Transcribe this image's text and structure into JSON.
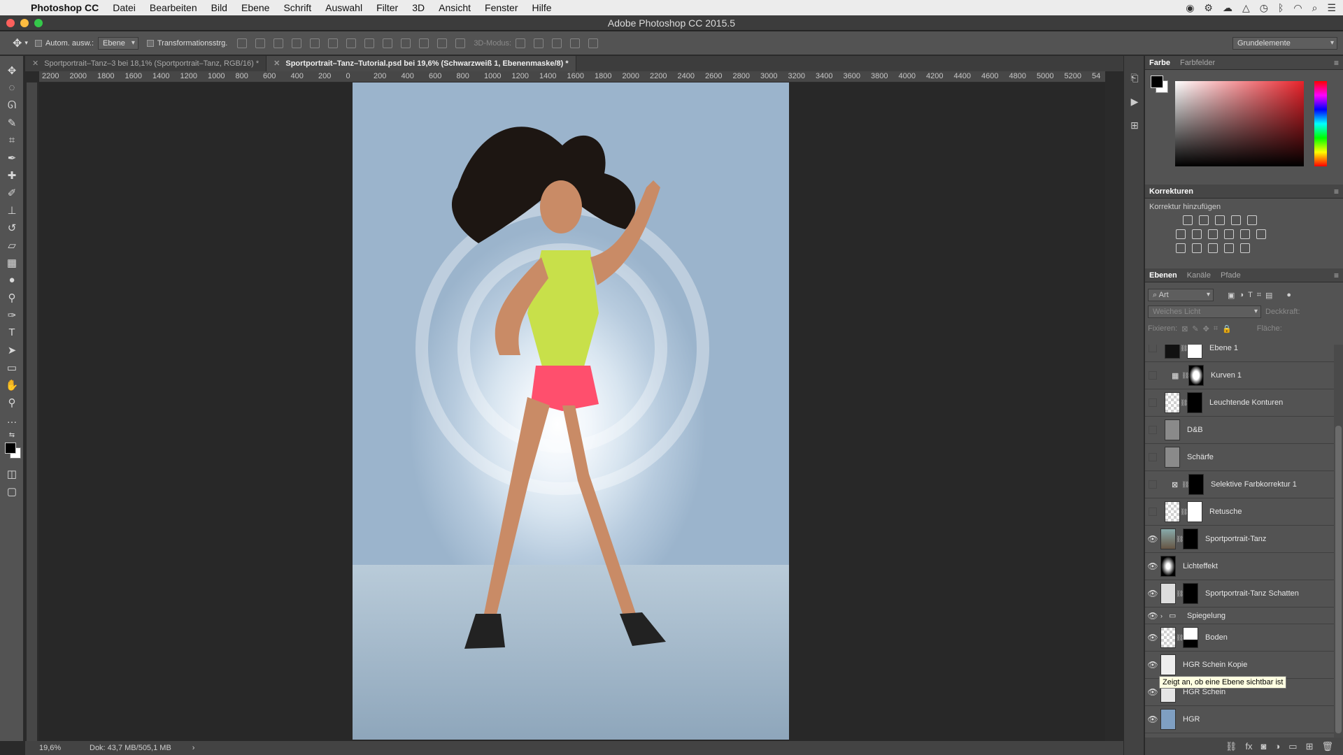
{
  "menubar": {
    "app": "Photoshop CC",
    "items": [
      "Datei",
      "Bearbeiten",
      "Bild",
      "Ebene",
      "Schrift",
      "Auswahl",
      "Filter",
      "3D",
      "Ansicht",
      "Fenster",
      "Hilfe"
    ]
  },
  "window": {
    "title": "Adobe Photoshop CC 2015.5"
  },
  "options": {
    "auto_select_label": "Autom. ausw.:",
    "auto_select_value": "Ebene",
    "transform_label": "Transformationsstrg.",
    "mode3d_label": "3D-Modus:",
    "workspace": "Grundelemente"
  },
  "tabs": [
    {
      "label": "Sportportrait–Tanz–3 bei 18,1% (Sportportrait–Tanz, RGB/16) *"
    },
    {
      "label": "Sportportrait–Tanz–Tutorial.psd bei 19,6% (Schwarzweiß 1, Ebenenmaske/8) *"
    }
  ],
  "ruler_ticks": [
    "2200",
    "2000",
    "1800",
    "1600",
    "1400",
    "1200",
    "1000",
    "800",
    "600",
    "400",
    "200",
    "0",
    "200",
    "400",
    "600",
    "800",
    "1000",
    "1200",
    "1400",
    "1600",
    "1800",
    "2000",
    "2200",
    "2400",
    "2600",
    "2800",
    "3000",
    "3200",
    "3400",
    "3600",
    "3800",
    "4000",
    "4200",
    "4400",
    "4600",
    "4800",
    "5000",
    "5200",
    "54"
  ],
  "status": {
    "zoom": "19,6%",
    "doc": "Dok: 43,7 MB/505,1 MB"
  },
  "color_panel": {
    "tabs": [
      "Farbe",
      "Farbfelder"
    ],
    "fg": "#000000",
    "bg": "#ffffff"
  },
  "adjustments": {
    "title": "Korrekturen",
    "subtitle": "Korrektur hinzufügen"
  },
  "layers_panel": {
    "tabs": [
      "Ebenen",
      "Kanäle",
      "Pfade"
    ],
    "filter": "Art",
    "blend_mode": "Weiches Licht",
    "opacity_label": "Deckkraft:",
    "lock_label": "Fixieren:",
    "fill_label": "Fläche:"
  },
  "layers": [
    {
      "name": "Ebene 1",
      "visible": false,
      "mask": true
    },
    {
      "name": "Kurven 1",
      "visible": false,
      "mask": true
    },
    {
      "name": "Leuchtende Konturen",
      "visible": false,
      "mask": true
    },
    {
      "name": "D&B",
      "visible": false,
      "mask": false
    },
    {
      "name": "Schärfe",
      "visible": false,
      "mask": false
    },
    {
      "name": "Selektive Farbkorrektur 1",
      "visible": false,
      "mask": true
    },
    {
      "name": "Retusche",
      "visible": false,
      "mask": true
    },
    {
      "name": "Sportportrait-Tanz",
      "visible": true,
      "mask": true
    },
    {
      "name": "Lichteffekt",
      "visible": true,
      "mask": false
    },
    {
      "name": "Sportportrait-Tanz Schatten",
      "visible": true,
      "mask": true
    },
    {
      "name": "Spiegelung",
      "visible": true,
      "folder": true
    },
    {
      "name": "Boden",
      "visible": true,
      "mask": true
    },
    {
      "name": "HGR Schein Kopie",
      "visible": true,
      "mask": false
    },
    {
      "name": "HGR Schein",
      "visible": true,
      "mask": false
    },
    {
      "name": "HGR",
      "visible": true,
      "mask": false
    }
  ],
  "tooltip": "Zeigt an, ob eine Ebene sichtbar ist"
}
